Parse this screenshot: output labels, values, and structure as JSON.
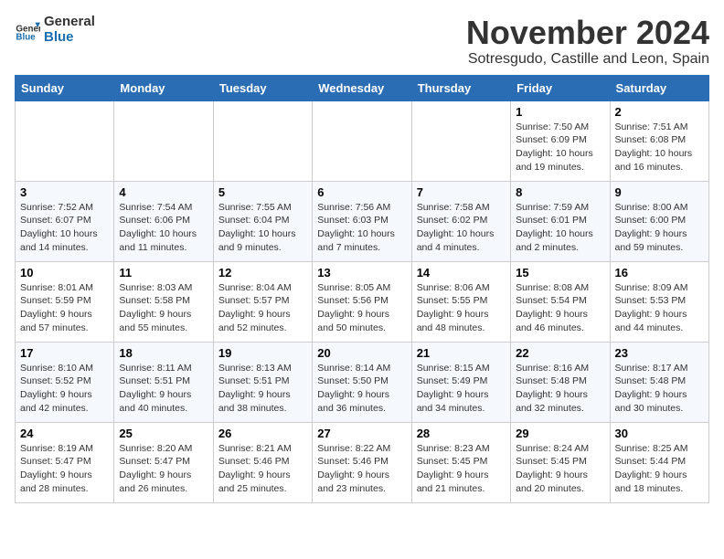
{
  "header": {
    "logo_general": "General",
    "logo_blue": "Blue",
    "month_title": "November 2024",
    "location": "Sotresgudo, Castille and Leon, Spain"
  },
  "calendar": {
    "days_of_week": [
      "Sunday",
      "Monday",
      "Tuesday",
      "Wednesday",
      "Thursday",
      "Friday",
      "Saturday"
    ],
    "weeks": [
      [
        {
          "day": "",
          "info": ""
        },
        {
          "day": "",
          "info": ""
        },
        {
          "day": "",
          "info": ""
        },
        {
          "day": "",
          "info": ""
        },
        {
          "day": "",
          "info": ""
        },
        {
          "day": "1",
          "info": "Sunrise: 7:50 AM\nSunset: 6:09 PM\nDaylight: 10 hours and 19 minutes."
        },
        {
          "day": "2",
          "info": "Sunrise: 7:51 AM\nSunset: 6:08 PM\nDaylight: 10 hours and 16 minutes."
        }
      ],
      [
        {
          "day": "3",
          "info": "Sunrise: 7:52 AM\nSunset: 6:07 PM\nDaylight: 10 hours and 14 minutes."
        },
        {
          "day": "4",
          "info": "Sunrise: 7:54 AM\nSunset: 6:06 PM\nDaylight: 10 hours and 11 minutes."
        },
        {
          "day": "5",
          "info": "Sunrise: 7:55 AM\nSunset: 6:04 PM\nDaylight: 10 hours and 9 minutes."
        },
        {
          "day": "6",
          "info": "Sunrise: 7:56 AM\nSunset: 6:03 PM\nDaylight: 10 hours and 7 minutes."
        },
        {
          "day": "7",
          "info": "Sunrise: 7:58 AM\nSunset: 6:02 PM\nDaylight: 10 hours and 4 minutes."
        },
        {
          "day": "8",
          "info": "Sunrise: 7:59 AM\nSunset: 6:01 PM\nDaylight: 10 hours and 2 minutes."
        },
        {
          "day": "9",
          "info": "Sunrise: 8:00 AM\nSunset: 6:00 PM\nDaylight: 9 hours and 59 minutes."
        }
      ],
      [
        {
          "day": "10",
          "info": "Sunrise: 8:01 AM\nSunset: 5:59 PM\nDaylight: 9 hours and 57 minutes."
        },
        {
          "day": "11",
          "info": "Sunrise: 8:03 AM\nSunset: 5:58 PM\nDaylight: 9 hours and 55 minutes."
        },
        {
          "day": "12",
          "info": "Sunrise: 8:04 AM\nSunset: 5:57 PM\nDaylight: 9 hours and 52 minutes."
        },
        {
          "day": "13",
          "info": "Sunrise: 8:05 AM\nSunset: 5:56 PM\nDaylight: 9 hours and 50 minutes."
        },
        {
          "day": "14",
          "info": "Sunrise: 8:06 AM\nSunset: 5:55 PM\nDaylight: 9 hours and 48 minutes."
        },
        {
          "day": "15",
          "info": "Sunrise: 8:08 AM\nSunset: 5:54 PM\nDaylight: 9 hours and 46 minutes."
        },
        {
          "day": "16",
          "info": "Sunrise: 8:09 AM\nSunset: 5:53 PM\nDaylight: 9 hours and 44 minutes."
        }
      ],
      [
        {
          "day": "17",
          "info": "Sunrise: 8:10 AM\nSunset: 5:52 PM\nDaylight: 9 hours and 42 minutes."
        },
        {
          "day": "18",
          "info": "Sunrise: 8:11 AM\nSunset: 5:51 PM\nDaylight: 9 hours and 40 minutes."
        },
        {
          "day": "19",
          "info": "Sunrise: 8:13 AM\nSunset: 5:51 PM\nDaylight: 9 hours and 38 minutes."
        },
        {
          "day": "20",
          "info": "Sunrise: 8:14 AM\nSunset: 5:50 PM\nDaylight: 9 hours and 36 minutes."
        },
        {
          "day": "21",
          "info": "Sunrise: 8:15 AM\nSunset: 5:49 PM\nDaylight: 9 hours and 34 minutes."
        },
        {
          "day": "22",
          "info": "Sunrise: 8:16 AM\nSunset: 5:48 PM\nDaylight: 9 hours and 32 minutes."
        },
        {
          "day": "23",
          "info": "Sunrise: 8:17 AM\nSunset: 5:48 PM\nDaylight: 9 hours and 30 minutes."
        }
      ],
      [
        {
          "day": "24",
          "info": "Sunrise: 8:19 AM\nSunset: 5:47 PM\nDaylight: 9 hours and 28 minutes."
        },
        {
          "day": "25",
          "info": "Sunrise: 8:20 AM\nSunset: 5:47 PM\nDaylight: 9 hours and 26 minutes."
        },
        {
          "day": "26",
          "info": "Sunrise: 8:21 AM\nSunset: 5:46 PM\nDaylight: 9 hours and 25 minutes."
        },
        {
          "day": "27",
          "info": "Sunrise: 8:22 AM\nSunset: 5:46 PM\nDaylight: 9 hours and 23 minutes."
        },
        {
          "day": "28",
          "info": "Sunrise: 8:23 AM\nSunset: 5:45 PM\nDaylight: 9 hours and 21 minutes."
        },
        {
          "day": "29",
          "info": "Sunrise: 8:24 AM\nSunset: 5:45 PM\nDaylight: 9 hours and 20 minutes."
        },
        {
          "day": "30",
          "info": "Sunrise: 8:25 AM\nSunset: 5:44 PM\nDaylight: 9 hours and 18 minutes."
        }
      ]
    ]
  }
}
